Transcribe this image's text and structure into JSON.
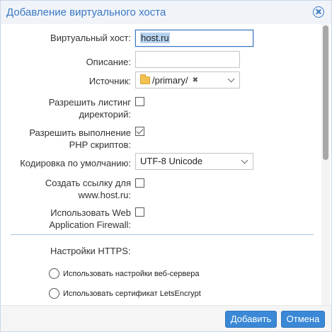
{
  "dialog": {
    "title": "Добавление виртуального хоста",
    "close_icon": "close-circle-icon"
  },
  "form": {
    "virtual_host": {
      "label": "Виртуальный хост:",
      "value": "host.ru"
    },
    "description": {
      "label": "Описание:",
      "value": ""
    },
    "source": {
      "label": "Источник:",
      "tag": "/primary/",
      "tag_remove": "✖",
      "icon": "folder-icon"
    },
    "dir_listing": {
      "label": "Разрешить листинг\nдиректорий:",
      "checked": false
    },
    "php_exec": {
      "label": "Разрешить выполнение\nPHP скриптов:",
      "checked": true
    },
    "encoding": {
      "label": "Кодировка по умолчанию:",
      "value": "UTF-8 Unicode"
    },
    "www_link": {
      "label": "Создать ссылку для\nwww.host.ru:",
      "checked": false
    },
    "waf": {
      "label": "Использовать Web\nApplication Firewall:",
      "checked": false
    }
  },
  "https": {
    "title": "Настройки HTTPS:",
    "options": [
      {
        "label": "Использовать настройки веб-сервера",
        "selected": false
      },
      {
        "label": "Использовать сертификат LetsEncrypt",
        "selected": false
      }
    ]
  },
  "footer": {
    "add_label": "Добавить",
    "cancel_label": "Отмена"
  },
  "colors": {
    "accent": "#3a78c3",
    "button": "#3a88d6"
  }
}
